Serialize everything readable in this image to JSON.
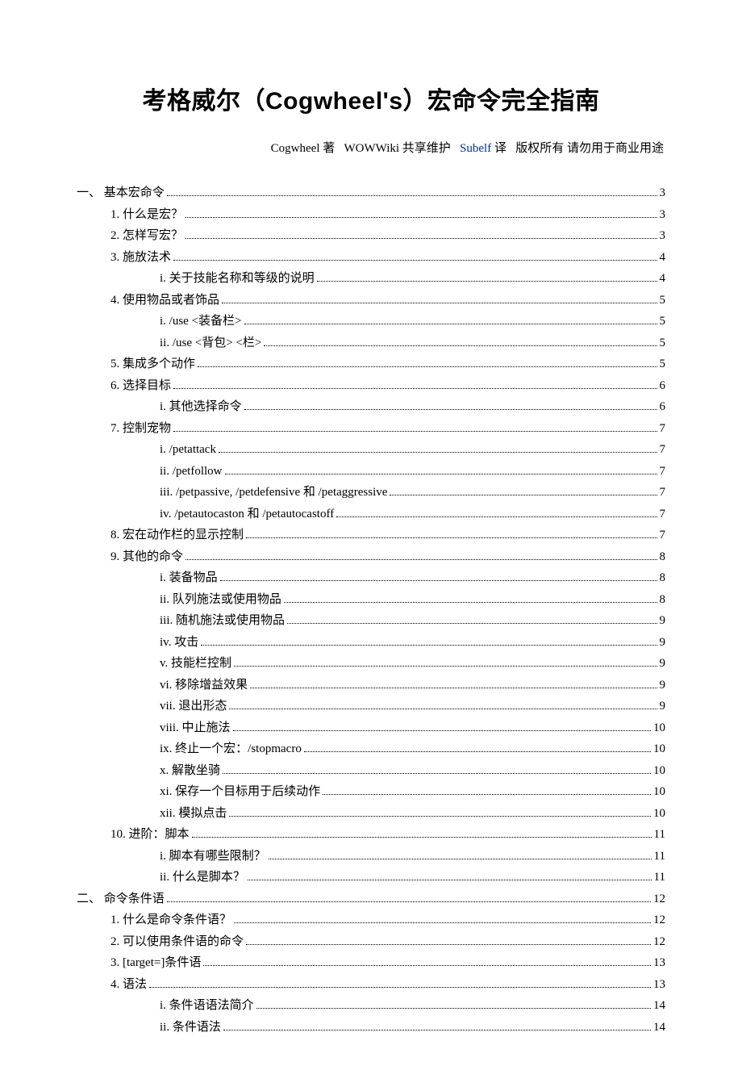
{
  "title": "考格威尔（Cogwheel's）宏命令完全指南",
  "byline": {
    "author": "Cogwheel 著",
    "maintain": "WOWWiki 共享维护",
    "translator": "Subelf",
    "translator_suffix": "译",
    "rights": "版权所有 请勿用于商业用途"
  },
  "toc": [
    {
      "level": 0,
      "label": "一、 基本宏命令",
      "page": "3"
    },
    {
      "level": 1,
      "label": "1. 什么是宏？",
      "page": "3"
    },
    {
      "level": 1,
      "label": "2. 怎样写宏？",
      "page": "3"
    },
    {
      "level": 1,
      "label": "3. 施放法术",
      "page": "4"
    },
    {
      "level": 2,
      "label": "i. 关于技能名称和等级的说明",
      "page": "4"
    },
    {
      "level": 1,
      "label": "4. 使用物品或者饰品",
      "page": "5"
    },
    {
      "level": 2,
      "label": "i. /use <装备栏>",
      "page": "5"
    },
    {
      "level": 2,
      "label": "ii. /use <背包> <栏>",
      "page": "5"
    },
    {
      "level": 1,
      "label": "5. 集成多个动作",
      "page": "5"
    },
    {
      "level": 1,
      "label": "6. 选择目标",
      "page": "6"
    },
    {
      "level": 2,
      "label": "i. 其他选择命令",
      "page": "6"
    },
    {
      "level": 1,
      "label": "7. 控制宠物",
      "page": "7"
    },
    {
      "level": 2,
      "label": "i. /petattack",
      "page": "7"
    },
    {
      "level": 2,
      "label": "ii. /petfollow",
      "page": "7"
    },
    {
      "level": 2,
      "label": "iii. /petpassive, /petdefensive  和  /petaggressive",
      "page": "7"
    },
    {
      "level": 2,
      "label": "iv. /petautocaston  和  /petautocastoff",
      "page": "7"
    },
    {
      "level": 1,
      "label": "8. 宏在动作栏的显示控制",
      "page": "7"
    },
    {
      "level": 1,
      "label": "9. 其他的命令",
      "page": "8"
    },
    {
      "level": 2,
      "label": "i. 装备物品",
      "page": "8"
    },
    {
      "level": 2,
      "label": "ii. 队列施法或使用物品",
      "page": "8"
    },
    {
      "level": 2,
      "label": "iii. 随机施法或使用物品",
      "page": "9"
    },
    {
      "level": 2,
      "label": "iv. 攻击",
      "page": "9"
    },
    {
      "level": 2,
      "label": "v. 技能栏控制",
      "page": "9"
    },
    {
      "level": 2,
      "label": "vi. 移除增益效果",
      "page": "9"
    },
    {
      "level": 2,
      "label": "vii. 退出形态",
      "page": "9"
    },
    {
      "level": 2,
      "label": "viii. 中止施法",
      "page": "10"
    },
    {
      "level": 2,
      "label": "ix. 终止一个宏：/stopmacro",
      "page": "10"
    },
    {
      "level": 2,
      "label": "x. 解散坐骑",
      "page": "10"
    },
    {
      "level": 2,
      "label": "xi. 保存一个目标用于后续动作",
      "page": "10"
    },
    {
      "level": 2,
      "label": "xii. 模拟点击",
      "page": "10"
    },
    {
      "level": 1,
      "label": "10.       进阶：脚本",
      "page": "11"
    },
    {
      "level": 2,
      "label": "i. 脚本有哪些限制？",
      "page": "11"
    },
    {
      "level": 2,
      "label": "ii. 什么是脚本？",
      "page": "11"
    },
    {
      "level": 0,
      "label": "二、 命令条件语",
      "page": "12"
    },
    {
      "level": 1,
      "label": "1. 什么是命令条件语？",
      "page": "12"
    },
    {
      "level": 1,
      "label": "2. 可以使用条件语的命令",
      "page": "12"
    },
    {
      "level": 1,
      "label": "3. [target=]条件语",
      "page": "13"
    },
    {
      "level": 1,
      "label": "4. 语法",
      "page": "13"
    },
    {
      "level": 2,
      "label": "i. 条件语语法简介",
      "page": "14"
    },
    {
      "level": 2,
      "label": "ii. 条件语法",
      "page": "14"
    }
  ]
}
